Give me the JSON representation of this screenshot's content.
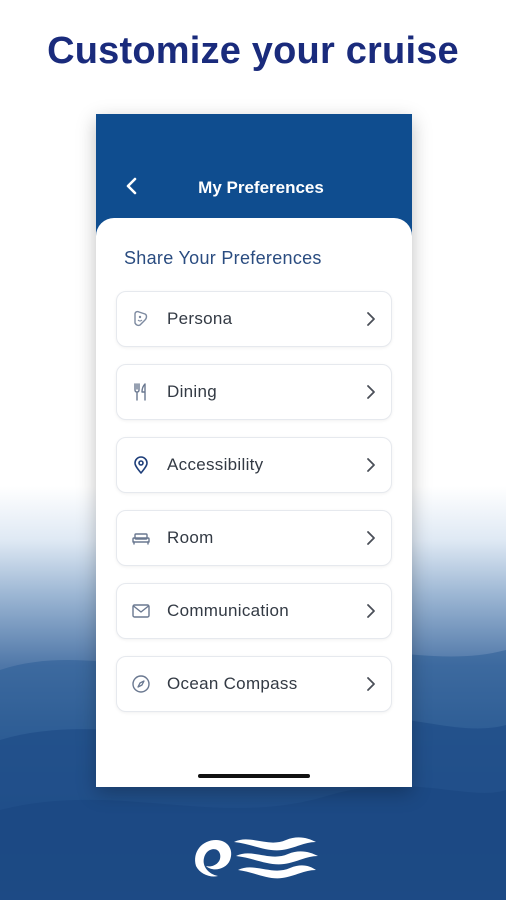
{
  "headline": "Customize your cruise",
  "screen": {
    "title": "My Preferences",
    "section_title": "Share Your Preferences"
  },
  "items": [
    {
      "label": "Persona",
      "icon": "persona-icon"
    },
    {
      "label": "Dining",
      "icon": "utensils-icon"
    },
    {
      "label": "Accessibility",
      "icon": "location-pin-icon"
    },
    {
      "label": "Room",
      "icon": "bed-icon"
    },
    {
      "label": "Communication",
      "icon": "envelope-icon"
    },
    {
      "label": "Ocean Compass",
      "icon": "compass-icon"
    }
  ],
  "colors": {
    "headline": "#1a2b7c",
    "header_blue": "#0f4d8f",
    "section_title": "#2a4c80",
    "icon_stroke": "#1f3f7a"
  },
  "logo": "princess-seawitch-logo"
}
